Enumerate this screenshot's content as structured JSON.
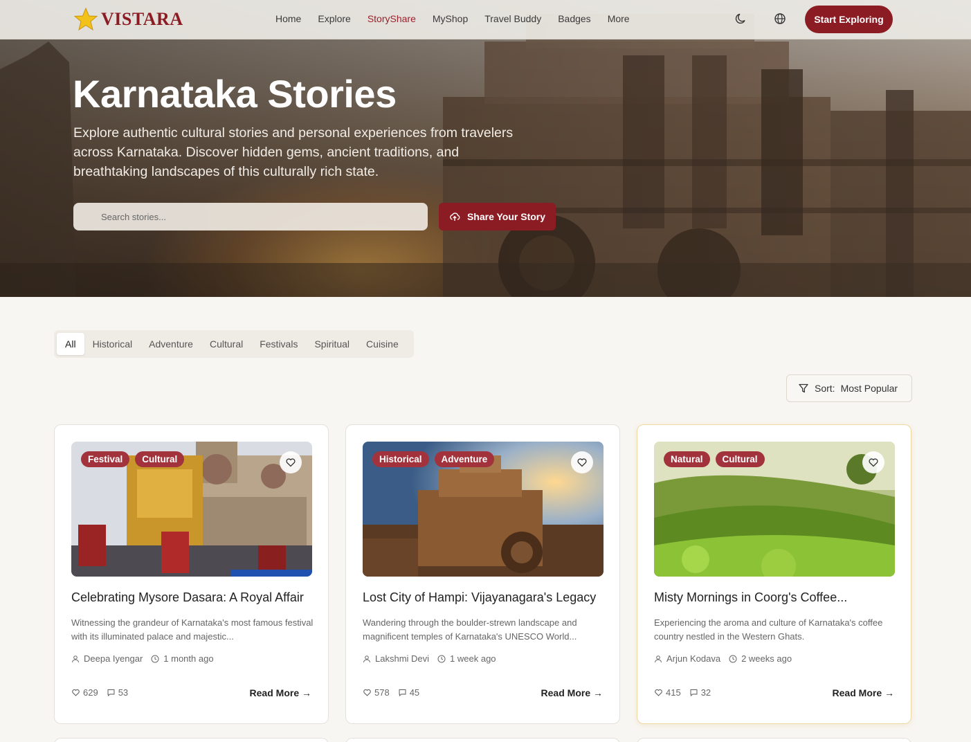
{
  "brand": {
    "name": "VISTARA",
    "accent": "#8c1c24"
  },
  "nav": {
    "links": [
      "Home",
      "Explore",
      "StoryShare",
      "MyShop",
      "Travel Buddy",
      "Badges",
      "More"
    ],
    "active": "StoryShare",
    "cta": "Start Exploring",
    "icons": [
      "moon-icon",
      "globe-icon"
    ]
  },
  "hero": {
    "title": "Karnataka Stories",
    "subtitle": "Explore authentic cultural stories and personal experiences from travelers across Karnataka. Discover hidden gems, ancient traditions, and breathtaking landscapes of this culturally rich state.",
    "search_placeholder": "Search stories...",
    "share_button": "Share Your Story"
  },
  "filters": {
    "items": [
      "All",
      "Historical",
      "Adventure",
      "Cultural",
      "Festivals",
      "Spiritual",
      "Cuisine"
    ],
    "active": "All"
  },
  "sort": {
    "label": "Sort:",
    "value": "Most Popular"
  },
  "stories": [
    {
      "tags": [
        "Festival",
        "Cultural"
      ],
      "title": "Celebrating Mysore Dasara: A Royal Affair",
      "excerpt": "Witnessing the grandeur of Karnataka's most famous festival with its illuminated palace and majestic...",
      "author": "Deepa Iyengar",
      "time": "1 month ago",
      "likes": "629",
      "comments": "53",
      "read_more": "Read More →"
    },
    {
      "tags": [
        "Historical",
        "Adventure"
      ],
      "title": "Lost City of Hampi: Vijayanagara's Legacy",
      "excerpt": "Wandering through the boulder-strewn landscape and magnificent temples of Karnataka's UNESCO World...",
      "author": "Lakshmi Devi",
      "time": "1 week ago",
      "likes": "578",
      "comments": "45",
      "read_more": "Read More →"
    },
    {
      "tags": [
        "Natural",
        "Cultural"
      ],
      "title": "Misty Mornings in Coorg's Coffee...",
      "excerpt": "Experiencing the aroma and culture of Karnataka's coffee country nestled in the Western Ghats.",
      "author": "Arjun Kodava",
      "time": "2 weeks ago",
      "likes": "415",
      "comments": "32",
      "read_more": "Read More →"
    }
  ]
}
